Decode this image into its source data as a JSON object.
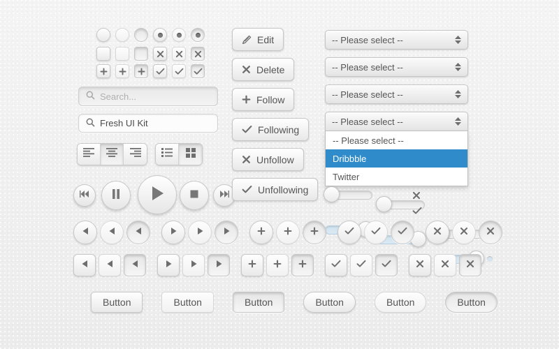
{
  "meta": {
    "title": "Fresh UI Kit",
    "accent": "#2f8bc9",
    "bg": "#f1f1f1",
    "text": "#555555"
  },
  "controls": {
    "radios": [
      {
        "name": "radio-raised-off",
        "selected": false,
        "style": "raised"
      },
      {
        "name": "radio-flat-off",
        "selected": false,
        "style": "flat"
      },
      {
        "name": "radio-inset-off",
        "selected": false,
        "style": "inset"
      },
      {
        "name": "radio-raised-on",
        "selected": true,
        "style": "raised"
      },
      {
        "name": "radio-flat-on",
        "selected": true,
        "style": "flat"
      },
      {
        "name": "radio-inset-on",
        "selected": true,
        "style": "inset"
      }
    ],
    "checkbox_row_x": [
      {
        "name": "checkbox-raised-empty",
        "glyph": "",
        "style": "raised"
      },
      {
        "name": "checkbox-flat-empty",
        "glyph": "",
        "style": "flat"
      },
      {
        "name": "checkbox-inset-empty",
        "glyph": "",
        "style": "inset"
      },
      {
        "name": "checkbox-raised-cross",
        "glyph": "cross-icon",
        "style": "raised"
      },
      {
        "name": "checkbox-flat-cross",
        "glyph": "cross-icon",
        "style": "flat"
      },
      {
        "name": "checkbox-inset-cross",
        "glyph": "cross-icon",
        "style": "inset"
      }
    ],
    "checkbox_row_check": [
      {
        "name": "checkbox-raised-plus",
        "glyph": "plus-icon",
        "style": "raised"
      },
      {
        "name": "checkbox-flat-plus",
        "glyph": "plus-icon",
        "style": "flat"
      },
      {
        "name": "checkbox-inset-plus",
        "glyph": "plus-icon",
        "style": "inset"
      },
      {
        "name": "checkbox-raised-check",
        "glyph": "check-icon",
        "style": "raised"
      },
      {
        "name": "checkbox-flat-check",
        "glyph": "check-icon",
        "style": "flat"
      },
      {
        "name": "checkbox-inset-check",
        "glyph": "check-icon",
        "style": "inset"
      }
    ]
  },
  "search": {
    "placeholder_field": {
      "placeholder": "Search...",
      "icon": "search-icon"
    },
    "value_field": {
      "value": "Fresh UI Kit",
      "icon": "search-icon"
    }
  },
  "align_group": {
    "items": [
      {
        "name": "align-left",
        "icon": "align-left-icon",
        "active": false
      },
      {
        "name": "align-center",
        "icon": "align-center-icon",
        "active": true
      },
      {
        "name": "align-right",
        "icon": "align-right-icon",
        "active": false
      }
    ]
  },
  "view_group": {
    "items": [
      {
        "name": "list-view",
        "icon": "list-view-icon",
        "active": false
      },
      {
        "name": "grid-view",
        "icon": "grid-view-icon",
        "active": true
      }
    ]
  },
  "action_buttons": [
    {
      "name": "edit-button",
      "label": "Edit",
      "icon": "pencil-icon"
    },
    {
      "name": "delete-button",
      "label": "Delete",
      "icon": "cross-icon"
    },
    {
      "name": "follow-button",
      "label": "Follow",
      "icon": "plus-icon"
    },
    {
      "name": "following-button",
      "label": "Following",
      "icon": "check-icon"
    },
    {
      "name": "unfollow-button",
      "label": "Unfollow",
      "icon": "cross-icon"
    },
    {
      "name": "unfollowing-button",
      "label": "Unfollowing",
      "icon": "check-icon"
    }
  ],
  "selects": {
    "placeholder_label": "-- Please select --",
    "items": [
      {
        "name": "select-1",
        "value": "-- Please select --",
        "open": false
      },
      {
        "name": "select-2",
        "value": "-- Please select --",
        "open": false
      },
      {
        "name": "select-3",
        "value": "-- Please select --",
        "open": false
      },
      {
        "name": "select-4",
        "value": "-- Please select --",
        "open": true
      }
    ],
    "options": [
      {
        "label": "-- Please select --",
        "highlighted": false
      },
      {
        "label": "Dribbble",
        "highlighted": true
      },
      {
        "label": "Twitter",
        "highlighted": false
      }
    ]
  },
  "media_player": [
    {
      "name": "rewind-button",
      "icon": "rewind-icon",
      "size": 32
    },
    {
      "name": "pause-button",
      "icon": "pause-icon",
      "size": 42
    },
    {
      "name": "play-button",
      "icon": "play-icon",
      "size": 56
    },
    {
      "name": "stop-button",
      "icon": "stop-icon",
      "size": 42
    },
    {
      "name": "next-button",
      "icon": "fast-forward-icon",
      "size": 32
    }
  ],
  "icon_buttons": {
    "styles": [
      "raised",
      "flat",
      "inset"
    ],
    "groups": [
      {
        "name": "arrow-left-group",
        "icon": "arrow-left-icon"
      },
      {
        "name": "arrow-right-group",
        "icon": "arrow-right-icon"
      },
      {
        "name": "plus-group",
        "icon": "plus-icon"
      },
      {
        "name": "check-group",
        "icon": "check-icon"
      },
      {
        "name": "cross-group",
        "icon": "cross-icon"
      }
    ]
  },
  "toggles": [
    {
      "name": "toggle-off-1",
      "on": false,
      "dots": false
    },
    {
      "name": "toggle-off-2",
      "on": false,
      "dots": false
    },
    {
      "name": "toggle-on-1",
      "on": true,
      "dots": false
    },
    {
      "name": "toggle-on-2",
      "on": true,
      "dots": false
    },
    {
      "name": "slider-off-dots",
      "on": false,
      "dots": true
    },
    {
      "name": "slider-on-dots",
      "on": true,
      "dots": true
    }
  ],
  "toggle_marks": [
    {
      "name": "toggle-cross-mark",
      "icon": "cross-icon"
    },
    {
      "name": "toggle-check-mark",
      "icon": "check-icon"
    }
  ],
  "bottom_buttons": [
    {
      "name": "button-rect-raised",
      "label": "Button",
      "shape": "rr",
      "style": "raised"
    },
    {
      "name": "button-rect-flat",
      "label": "Button",
      "shape": "rr",
      "style": "flat"
    },
    {
      "name": "button-rect-pressed",
      "label": "Button",
      "shape": "rr",
      "style": "inset"
    },
    {
      "name": "button-pill-raised",
      "label": "Button",
      "shape": "pill",
      "style": "raised"
    },
    {
      "name": "button-pill-flat",
      "label": "Button",
      "shape": "pill",
      "style": "flat"
    },
    {
      "name": "button-pill-pressed",
      "label": "Button",
      "shape": "pill",
      "style": "inset"
    }
  ]
}
